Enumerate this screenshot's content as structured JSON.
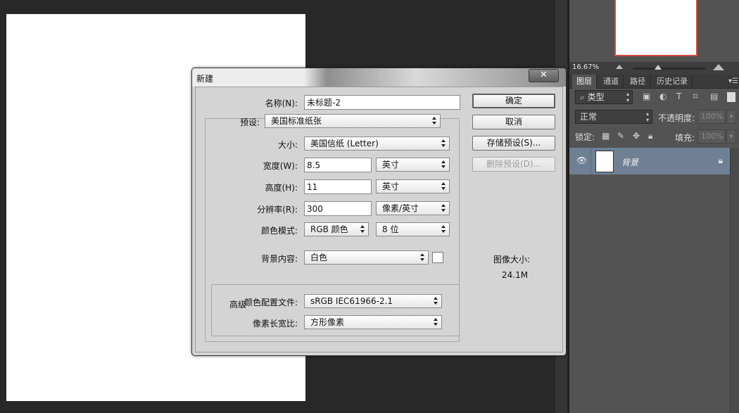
{
  "navigator": {
    "zoom": "16.67%"
  },
  "layers_panel": {
    "tabs": [
      "图层",
      "通道",
      "路径",
      "历史记录"
    ],
    "filter_type": "类型",
    "blend_mode": "正常",
    "opacity_label": "不透明度:",
    "opacity_value": "100%",
    "lock_label": "锁定:",
    "fill_label": "填充:",
    "fill_value": "100%",
    "layer_name": "背景"
  },
  "dialog": {
    "title": "新建",
    "close_label": "✕",
    "fields": {
      "name_label": "名称(N):",
      "name_value": "未标题-2",
      "preset_label": "预设:",
      "preset_value": "美国标准纸张",
      "size_label": "大小:",
      "size_value": "美国信纸 (Letter)",
      "width_label": "宽度(W):",
      "width_value": "8.5",
      "width_unit": "英寸",
      "height_label": "高度(H):",
      "height_value": "11",
      "height_unit": "英寸",
      "resolution_label": "分辨率(R):",
      "resolution_value": "300",
      "resolution_unit": "像素/英寸",
      "color_mode_label": "颜色模式:",
      "color_mode_value": "RGB 颜色",
      "bit_depth_value": "8 位",
      "background_label": "背景内容:",
      "background_value": "白色",
      "advanced_label": "高级",
      "profile_label": "颜色配置文件:",
      "profile_value": "sRGB IEC61966-2.1",
      "pixel_aspect_label": "像素长宽比:",
      "pixel_aspect_value": "方形像素"
    },
    "buttons": {
      "ok": "确定",
      "cancel": "取消",
      "save_preset": "存储预设(S)...",
      "delete_preset": "删除预设(D)..."
    },
    "image_size_label": "图像大小:",
    "image_size_value": "24.1M"
  }
}
